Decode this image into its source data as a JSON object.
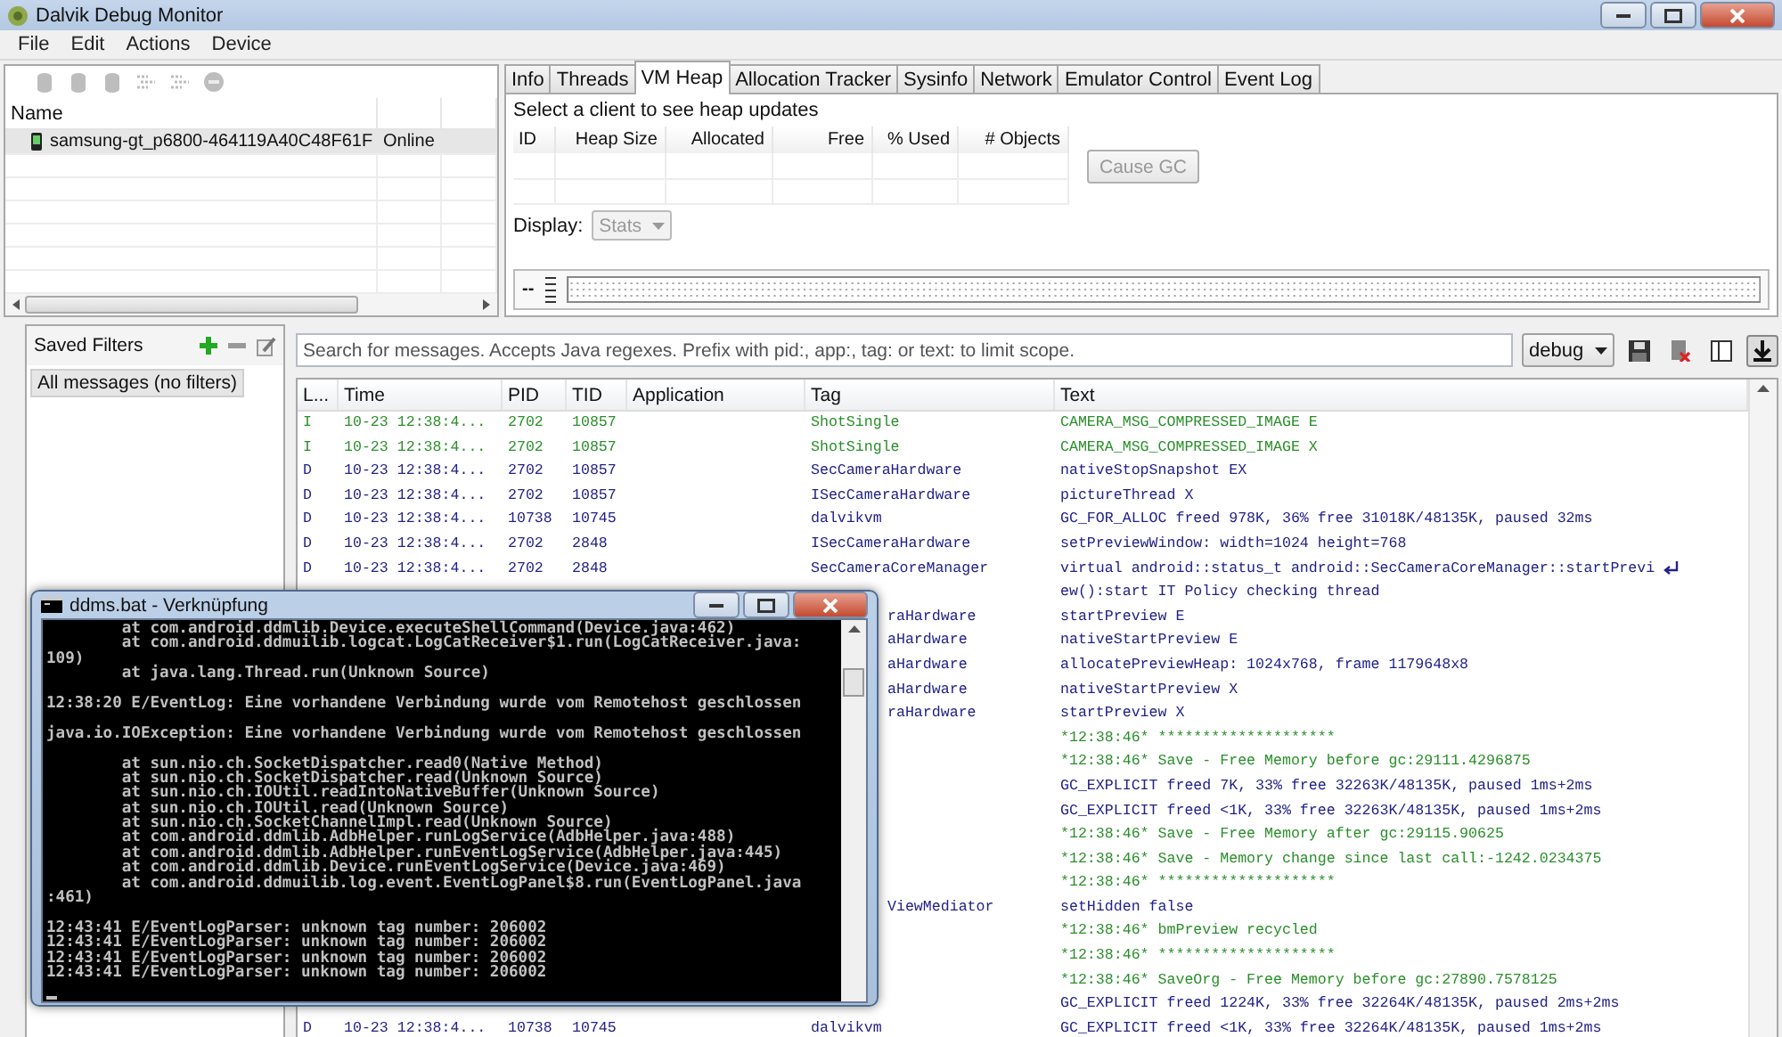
{
  "window": {
    "title": "Dalvik Debug Monitor"
  },
  "menu": [
    "File",
    "Edit",
    "Actions",
    "Device"
  ],
  "device_toolbar": {
    "disabled": true
  },
  "devices": {
    "columns": [
      "Name"
    ],
    "rows": [
      {
        "name": "samsung-gt_p6800-464119A40C48F61F",
        "status": "Online",
        "selected": true
      }
    ]
  },
  "tabs": [
    {
      "label": "Info",
      "selected": false
    },
    {
      "label": "Threads",
      "selected": false
    },
    {
      "label": "VM Heap",
      "selected": true
    },
    {
      "label": "Allocation Tracker",
      "selected": false
    },
    {
      "label": "Sysinfo",
      "selected": false
    },
    {
      "label": "Network",
      "selected": false
    },
    {
      "label": "Emulator Control",
      "selected": false
    },
    {
      "label": "Event Log",
      "selected": false
    }
  ],
  "heap": {
    "message": "Select a client to see heap updates",
    "columns": [
      "ID",
      "Heap Size",
      "Allocated",
      "Free",
      "% Used",
      "# Objects"
    ],
    "cause_gc": {
      "label": "Cause GC",
      "disabled": true
    },
    "display": {
      "label": "Display:",
      "value": "Stats",
      "disabled": true
    },
    "graph_label": "--"
  },
  "saved_filters": {
    "title": "Saved Filters",
    "items": [
      {
        "label": "All messages (no filters)",
        "selected": true
      }
    ]
  },
  "logcat": {
    "search_placeholder": "Search for messages. Accepts Java regexes. Prefix with pid:, app:, tag: or text: to limit scope.",
    "level_filter": "debug",
    "scroll_lock": {
      "pressed": true
    },
    "columns": [
      "L...",
      "Time",
      "PID",
      "TID",
      "Application",
      "Tag",
      "Text"
    ],
    "rows": [
      {
        "color": "#2a8f2a",
        "level": "I",
        "time": "10-23 12:38:4...",
        "pid": "2702",
        "tid": "10857",
        "tag": "ShotSingle",
        "text": "CAMERA_MSG_COMPRESSED_IMAGE E"
      },
      {
        "color": "#2a8f2a",
        "level": "I",
        "time": "10-23 12:38:4...",
        "pid": "2702",
        "tid": "10857",
        "tag": "ShotSingle",
        "text": "CAMERA_MSG_COMPRESSED_IMAGE X"
      },
      {
        "color": "#22228a",
        "level": "D",
        "time": "10-23 12:38:4...",
        "pid": "2702",
        "tid": "10857",
        "tag": "SecCameraHardware",
        "text": "nativeStopSnapshot EX"
      },
      {
        "color": "#22228a",
        "level": "D",
        "time": "10-23 12:38:4...",
        "pid": "2702",
        "tid": "10857",
        "tag": "ISecCameraHardware",
        "text": "pictureThread X"
      },
      {
        "color": "#22228a",
        "level": "D",
        "time": "10-23 12:38:4...",
        "pid": "10738",
        "tid": "10745",
        "tag": "dalvikvm",
        "text": "GC_FOR_ALLOC freed 978K, 36% free 31018K/48135K, paused 32ms"
      },
      {
        "color": "#22228a",
        "level": "D",
        "time": "10-23 12:38:4...",
        "pid": "2702",
        "tid": "2848",
        "tag": "ISecCameraHardware",
        "text": "setPreviewWindow: width=1024 height=768"
      },
      {
        "color": "#22228a",
        "level": "D",
        "time": "10-23 12:38:4...",
        "pid": "2702",
        "tid": "2848",
        "tag": "SecCameraCoreManager",
        "text": "virtual android::status_t android::SecCameraCoreManager::startPrevi",
        "continued": "ew():start IT Policy checking thread"
      },
      {
        "color": "#22228a",
        "tag": "raHardware",
        "text": "startPreview E"
      },
      {
        "color": "#22228a",
        "tag": "aHardware",
        "text": "nativeStartPreview E"
      },
      {
        "color": "#22228a",
        "tag": "aHardware",
        "text": "allocatePreviewHeap: 1024x768, frame 1179648x8"
      },
      {
        "color": "#22228a",
        "tag": "aHardware",
        "text": "nativeStartPreview X"
      },
      {
        "color": "#22228a",
        "tag": "raHardware",
        "text": "startPreview X"
      },
      {
        "color": "#2a8f2a",
        "text": "*12:38:46* ********************"
      },
      {
        "color": "#2a8f2a",
        "text": "*12:38:46* Save - Free Memory before gc:29111.4296875"
      },
      {
        "color": "#22228a",
        "text": "GC_EXPLICIT freed 7K, 33% free 32263K/48135K, paused 1ms+2ms"
      },
      {
        "color": "#22228a",
        "text": "GC_EXPLICIT freed <1K, 33% free 32263K/48135K, paused 1ms+2ms"
      },
      {
        "color": "#2a8f2a",
        "text": "*12:38:46* Save - Free Memory after gc:29115.90625"
      },
      {
        "color": "#2a8f2a",
        "text": "*12:38:46* Save - Memory change since last call:-1242.0234375"
      },
      {
        "color": "#2a8f2a",
        "text": "*12:38:46* ********************"
      },
      {
        "color": "#22228a",
        "tag": "ViewMediator",
        "text": "setHidden false"
      },
      {
        "color": "#2a8f2a",
        "text": "*12:38:46* bmPreview recycled"
      },
      {
        "color": "#2a8f2a",
        "text": "*12:38:46* ********************"
      },
      {
        "color": "#2a8f2a",
        "text": "*12:38:46* SaveOrg - Free Memory before gc:27890.7578125"
      },
      {
        "color": "#22228a",
        "text": "GC_EXPLICIT freed 1224K, 33% free 32264K/48135K, paused 2ms+2ms"
      },
      {
        "color": "#22228a",
        "level": "D",
        "time": "10-23 12:38:4...",
        "pid": "10738",
        "tid": "10745",
        "tag": "dalvikvm",
        "text": "GC_EXPLICIT freed <1K, 33% free 32264K/48135K, paused 1ms+2ms"
      }
    ]
  },
  "console": {
    "title": "ddms.bat - Verknüpfung",
    "blocks": [
      [
        "        at com.android.ddmlib.Device.executeShellCommand(Device.java:462)",
        "        at com.android.ddmuilib.logcat.LogCatReceiver$1.run(LogCatReceiver.java:",
        "109)",
        "        at java.lang.Thread.run(Unknown Source)"
      ],
      [
        "12:38:20 E/EventLog: Eine vorhandene Verbindung wurde vom Remotehost geschlossen"
      ],
      [
        "java.io.IOException: Eine vorhandene Verbindung wurde vom Remotehost geschlossen"
      ],
      [
        "        at sun.nio.ch.SocketDispatcher.read0(Native Method)",
        "        at sun.nio.ch.SocketDispatcher.read(Unknown Source)",
        "        at sun.nio.ch.IOUtil.readIntoNativeBuffer(Unknown Source)",
        "        at sun.nio.ch.IOUtil.read(Unknown Source)",
        "        at sun.nio.ch.SocketChannelImpl.read(Unknown Source)",
        "        at com.android.ddmlib.AdbHelper.runLogService(AdbHelper.java:488)",
        "        at com.android.ddmlib.AdbHelper.runEventLogService(AdbHelper.java:445)",
        "        at com.android.ddmlib.Device.runEventLogService(Device.java:469)",
        "        at com.android.ddmuilib.log.event.EventLogPanel$8.run(EventLogPanel.java",
        ":461)"
      ],
      [
        "12:43:41 E/EventLogParser: unknown tag number: 206002",
        "12:43:41 E/EventLogParser: unknown tag number: 206002",
        "12:43:41 E/EventLogParser: unknown tag number: 206002",
        "12:43:41 E/EventLogParser: unknown tag number: 206002"
      ]
    ]
  }
}
